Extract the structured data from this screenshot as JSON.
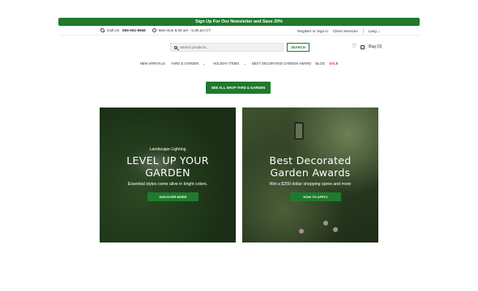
{
  "promo": {
    "text": "Sign Up For Our Newsletter and Save 20%"
  },
  "utility": {
    "call_label": "Call Us:",
    "phone": "866-652-8568",
    "hours": "Mon-Sun 8:30 am - 5:30 pm CT",
    "register": "Register or Sign in",
    "client_services": "Client Services",
    "language": "Lang"
  },
  "search": {
    "placeholder": "Search products...",
    "button": "SEARCH"
  },
  "cart": {
    "label": "Bag (0)"
  },
  "nav": {
    "items": [
      "NEW ARRIVALS",
      "YARD & GARDEN",
      "HOLIDAY ITEMS",
      "BEST DECORATED GARDEN AWARD",
      "BLOG",
      "SALE"
    ]
  },
  "cta": {
    "shop_all": "SEE ALL SHOP YARD & GARDEN"
  },
  "cards": [
    {
      "kicker": "Landscape Lighting",
      "title_line1": "LEVEL UP YOUR",
      "title_line2": "GARDEN",
      "subtitle": "Essential styles come alive in bright colors.",
      "button": "DISCOVER MORE"
    },
    {
      "title_line1": "Best Decorated",
      "title_line2": "Garden Awards",
      "subtitle": "Win a $250 dollar shopping spree and more",
      "button": "HOW TO APPLY"
    }
  ],
  "colors": {
    "brand_green": "#1f7a2e",
    "sale_red": "#d43535"
  }
}
